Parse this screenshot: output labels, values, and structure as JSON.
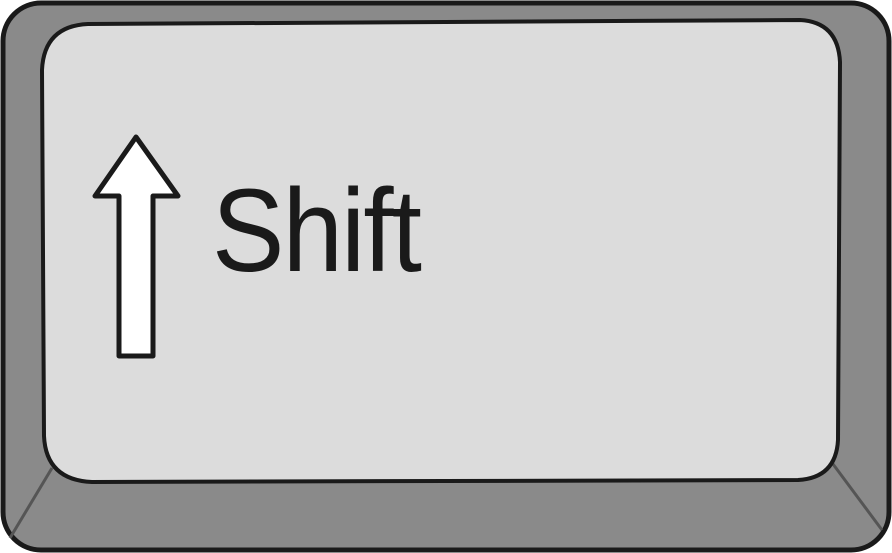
{
  "key": {
    "label": "Shift",
    "icon": "up-arrow-icon",
    "colors": {
      "outer_body": "#8a8a8a",
      "top_face": "#dcdcdc",
      "outline": "#1a1a1a"
    }
  }
}
